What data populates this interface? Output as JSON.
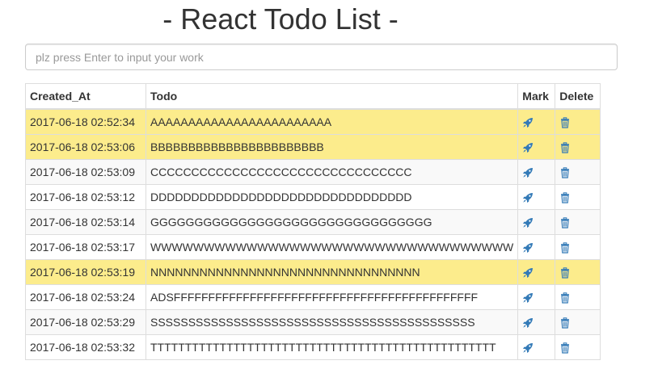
{
  "page": {
    "title": "- React Todo List -"
  },
  "input": {
    "placeholder": "plz press Enter to input your work",
    "value": ""
  },
  "table": {
    "headers": {
      "created_at": "Created_At",
      "todo": "Todo",
      "mark": "Mark",
      "delete": "Delete"
    },
    "rows": [
      {
        "created_at": "2017-06-18 02:52:34",
        "todo": "AAAAAAAAAAAAAAAAAAAAAAAA",
        "marked": true
      },
      {
        "created_at": "2017-06-18 02:53:06",
        "todo": "BBBBBBBBBBBBBBBBBBBBBBB",
        "marked": true
      },
      {
        "created_at": "2017-06-18 02:53:09",
        "todo": "CCCCCCCCCCCCCCCCCCCCCCCCCCCCCCCC",
        "marked": false
      },
      {
        "created_at": "2017-06-18 02:53:12",
        "todo": "DDDDDDDDDDDDDDDDDDDDDDDDDDDDDDDD",
        "marked": false
      },
      {
        "created_at": "2017-06-18 02:53:14",
        "todo": "GGGGGGGGGGGGGGGGGGGGGGGGGGGGGGGG",
        "marked": false
      },
      {
        "created_at": "2017-06-18 02:53:17",
        "todo": "WWWWWWWWWWWWWWWWWWWWWWWWWWWWWWWWWW",
        "marked": false
      },
      {
        "created_at": "2017-06-18 02:53:19",
        "todo": "NNNNNNNNNNNNNNNNNNNNNNNNNNNNNNNNN",
        "marked": true
      },
      {
        "created_at": "2017-06-18 02:53:24",
        "todo": "ADSFFFFFFFFFFFFFFFFFFFFFFFFFFFFFFFFFFFFFFFFFFFF",
        "marked": false
      },
      {
        "created_at": "2017-06-18 02:53:29",
        "todo": "SSSSSSSSSSSSSSSSSSSSSSSSSSSSSSSSSSSSSSSSSSS",
        "marked": false
      },
      {
        "created_at": "2017-06-18 02:53:32",
        "todo": "TTTTTTTTTTTTTTTTTTTTTTTTTTTTTTTTTTTTTTTTTTTTTTTTTT",
        "marked": false
      }
    ]
  },
  "icons": {
    "mark": "rocket-icon",
    "delete": "trash-icon"
  },
  "colors": {
    "marked_row": "#fcec8c",
    "striped_row": "#f9f9f9",
    "icon": "#337ab7",
    "border": "#dddddd"
  }
}
